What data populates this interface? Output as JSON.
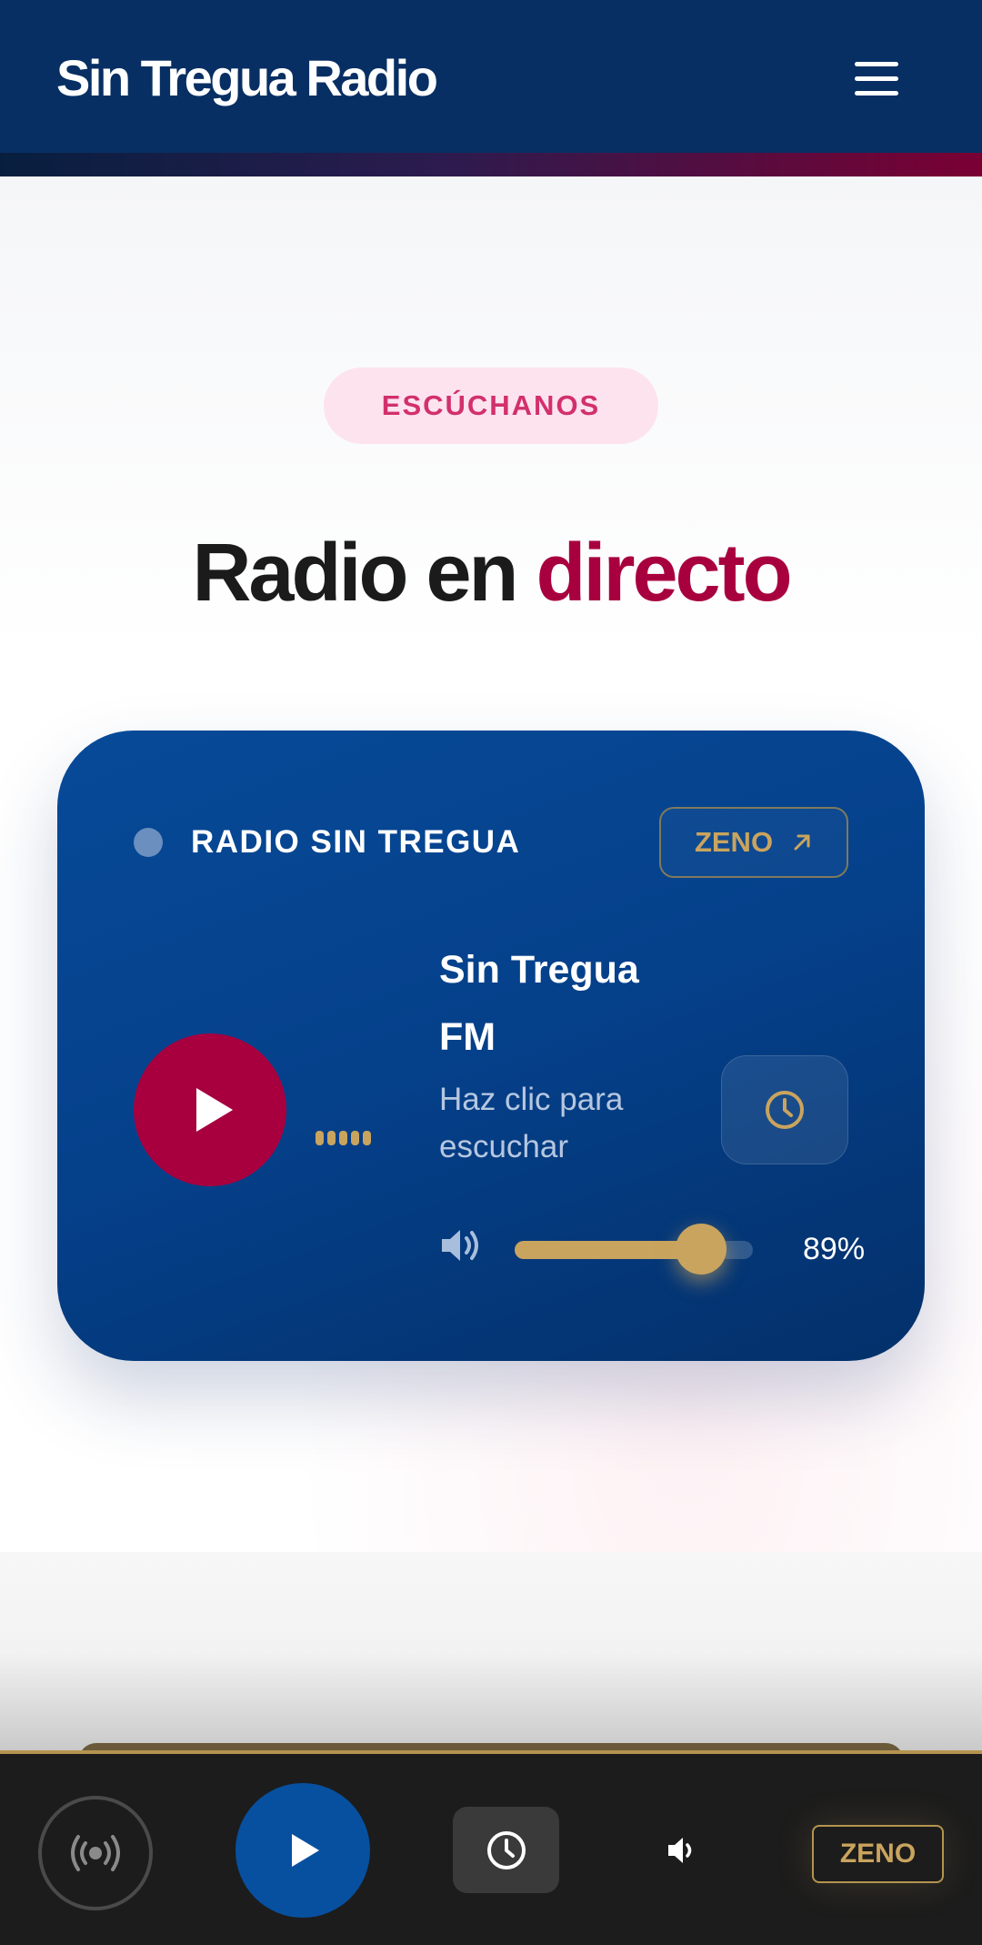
{
  "header": {
    "brand": "Sin Tregua Radio",
    "menu_icon": "hamburger-menu-icon"
  },
  "hero": {
    "pill": "ESCÚCHANOS",
    "title_main": "Radio en",
    "title_accent": "directo"
  },
  "player": {
    "station": "RADIO SIN TREGUA",
    "external_label": "ZENO",
    "external_icon": "arrow-up-right-icon",
    "track_title": "Sin Tregua FM",
    "track_subtitle": "Haz clic para escuchar",
    "volume": 89,
    "volume_text": "89%",
    "icons": [
      "play-icon",
      "equalizer-icon",
      "clock-icon",
      "volume-icon"
    ]
  },
  "bottom_bar": {
    "zeno_label": "ZENO",
    "icons": [
      "broadcast-icon",
      "play-icon",
      "clock-icon",
      "volume-icon"
    ]
  },
  "colors": {
    "navy": "#082f63",
    "card_blue": "#05408a",
    "crimson": "#a8003f",
    "gold": "#c9a45e",
    "pink_pill": "#fde3ed",
    "bar_dark": "#1c1c1c"
  }
}
